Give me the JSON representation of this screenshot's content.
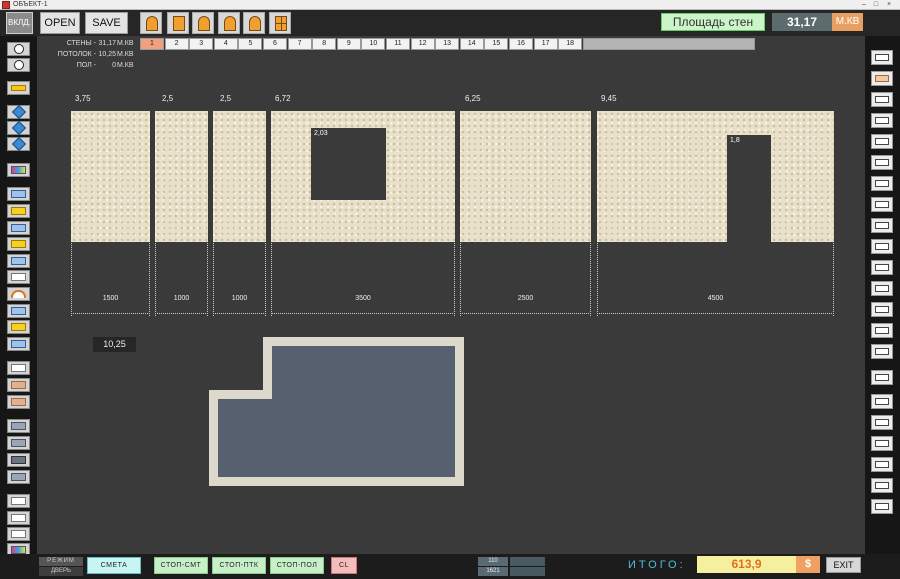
{
  "window": {
    "title": "ОБЪЕКТ-1"
  },
  "toolbar": {
    "insert_label": "ВКЛД.",
    "open_label": "OPEN",
    "save_label": "SAVE",
    "area_label": "Площадь стен",
    "area_value": "31,17",
    "area_unit": "М.КВ"
  },
  "totals": {
    "walls": {
      "label": "СТЕНЫ -",
      "value": "31,17",
      "unit": "М.КВ"
    },
    "ceiling": {
      "label": "ПОТОЛОК -",
      "value": "10,25",
      "unit": "М.КВ"
    },
    "floor": {
      "label": "ПОЛ -",
      "value": "0",
      "unit": "М.КВ"
    }
  },
  "tabs": [
    "1",
    "2",
    "3",
    "4",
    "5",
    "6",
    "7",
    "8",
    "9",
    "10",
    "11",
    "12",
    "13",
    "14",
    "15",
    "16",
    "17",
    "18"
  ],
  "active_tab": "1",
  "walls": [
    {
      "area": "3,75",
      "length": "1500"
    },
    {
      "area": "2,5",
      "length": "1000"
    },
    {
      "area": "2,5",
      "length": "1000"
    },
    {
      "area": "6,72",
      "length": "3500",
      "opening_area": "2,03"
    },
    {
      "area": "6,25",
      "length": "2500"
    },
    {
      "area": "9,45",
      "length": "4500",
      "opening_area": "1,8"
    }
  ],
  "floor": {
    "area": "10,25"
  },
  "bottom": {
    "mode_label": "РЕЖИМ",
    "door_label": "ДВЕРЬ",
    "estimate_label": "СМЕТА",
    "stop_smt_label": "СТОП-СМТ",
    "stop_ptk_label": "СТОП-ПТК",
    "stop_pol_label": "СТОП-ПОЛ",
    "cl_label": "CL",
    "stat1": "110",
    "stat2": "1621",
    "total_label": "ИТОГО:",
    "total_value": "613,9",
    "currency": "$",
    "exit_label": "EXIT"
  }
}
